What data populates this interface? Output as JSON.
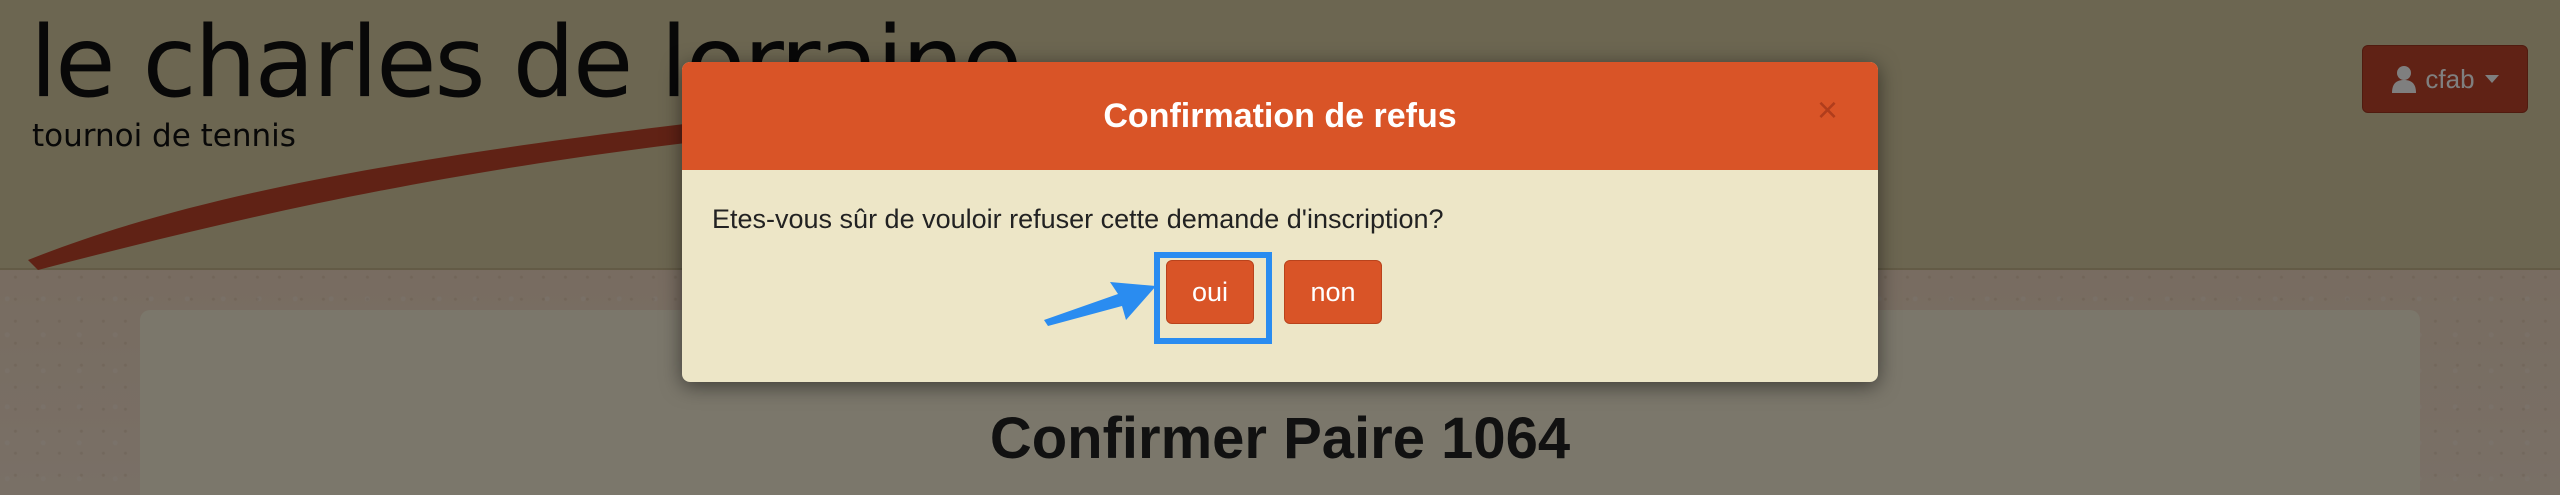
{
  "header": {
    "logo_title": "le charles de lorraine",
    "logo_subtitle": "tournoi de tennis",
    "user_menu_label": "cfab"
  },
  "page": {
    "title": "Confirmer Paire 1064"
  },
  "modal": {
    "title": "Confirmation de refus",
    "close_glyph": "×",
    "message": "Etes-vous sûr de vouloir refuser cette demande d'inscription?",
    "confirm_label": "oui",
    "cancel_label": "non"
  },
  "colors": {
    "accent": "#d95427",
    "modal_body": "#ede6c7",
    "highlight": "#2a8cf0",
    "user_menu": "#c0452a"
  },
  "icons": {
    "user": "user-icon",
    "caret": "caret-down-icon",
    "close": "close-icon",
    "annotation_arrow": "arrow-icon"
  }
}
